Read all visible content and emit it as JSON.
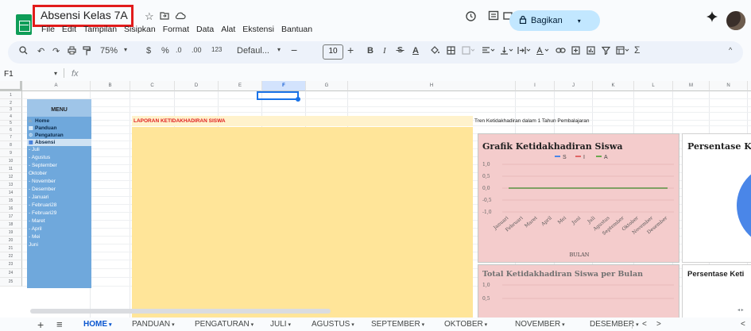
{
  "window": {
    "title": "Absensi Kelas 7A",
    "title_highlight_color": "#e21b1b",
    "menus": [
      "File",
      "Edit",
      "Tampilan",
      "Sisipkan",
      "Format",
      "Data",
      "Alat",
      "Ekstensi",
      "Bantuan"
    ],
    "share_label": "Bagikan",
    "icons": [
      "star-icon",
      "move-to-folder-icon",
      "cloud-status-icon",
      "history-icon",
      "comment-icon",
      "meet-icon",
      "lock-icon",
      "gemini-icon"
    ]
  },
  "toolbar": {
    "zoom": "75%",
    "currency": "$",
    "percent": "%",
    "decrease_decimal": ".0",
    "increase_decimal": ".00",
    "number_format": "123",
    "font": "Defaul...",
    "font_size": "10",
    "bold": "B",
    "italic": "I",
    "text_color": "A",
    "text_color_bar": "#000000",
    "minus": "−",
    "plus": "+",
    "sigma": "Σ"
  },
  "formula_bar": {
    "cell_ref": "F1",
    "fx": "fx"
  },
  "grid": {
    "columns": [
      "A",
      "B",
      "C",
      "D",
      "E",
      "F",
      "G",
      "H",
      "I",
      "J",
      "K",
      "L",
      "M",
      "N",
      "O"
    ],
    "selected_column": "F",
    "rows": [
      "1",
      "2",
      "3",
      "4",
      "5",
      "6",
      "7",
      "8",
      "9",
      "10",
      "11",
      "12",
      "13",
      "14",
      "15",
      "16",
      "17",
      "18",
      "19",
      "20",
      "21",
      "22",
      "23",
      "24",
      "25"
    ]
  },
  "menu": {
    "header": "MENU",
    "items": [
      {
        "label": "Home",
        "icon": "home-icon",
        "style": "bold"
      },
      {
        "label": "Panduan",
        "icon": "book-icon",
        "style": "bold"
      },
      {
        "label": "Pengaturan",
        "icon": "settings-icon",
        "style": "bold"
      },
      {
        "label": "Absensi",
        "icon": "calendar-icon",
        "style": "bold-light"
      },
      {
        "label": "- Juli"
      },
      {
        "label": "- Agustus"
      },
      {
        "label": "- September"
      },
      {
        "label": "  Oktober"
      },
      {
        "label": "- November"
      },
      {
        "label": "- Desember"
      },
      {
        "label": "- Januari"
      },
      {
        "label": "- Februari28"
      },
      {
        "label": "- Februari29"
      },
      {
        "label": "- Maret"
      },
      {
        "label": "- April"
      },
      {
        "label": "- Mei"
      },
      {
        "label": "  Juni"
      }
    ],
    "panel_color": "#6fa8dc",
    "header_color": "#9fc5e8"
  },
  "report": {
    "title": "LAPORAN KETIDAKHADIRAN SISWA",
    "title_color": "#e02020",
    "trend_label": "Tren Ketidakhadiran dalam 1 Tahun Pembalajaran",
    "fill_color": "#ffe599"
  },
  "charts": {
    "chart1_title": "Grafik Ketidakhadiran Siswa",
    "chart2_title": "Total Ketidakhadiran Siswa per Bulan",
    "chart3_title": "Persentase Kel",
    "chart4_title": "Persentase Keti"
  },
  "chart_data": [
    {
      "type": "line",
      "title": "Grafik Ketidakhadiran Siswa",
      "xlabel": "BULAN",
      "ylabel": "",
      "categories": [
        "Januari",
        "Februari",
        "Maret",
        "April",
        "Mei",
        "Juni",
        "Juli",
        "Agustus",
        "September",
        "Oktober",
        "November",
        "Desember"
      ],
      "yticks": [
        "1,0",
        "0,5",
        "0,0",
        "-0,5",
        "-1,0"
      ],
      "ylim": [
        -1,
        1
      ],
      "legend": "top",
      "grid": true,
      "series": [
        {
          "name": "S",
          "color": "#4a86e8",
          "values": [
            0,
            0,
            0,
            0,
            0,
            0,
            0,
            0,
            0,
            0,
            0,
            0
          ]
        },
        {
          "name": "I",
          "color": "#e06666",
          "values": [
            0,
            0,
            0,
            0,
            0,
            0,
            0,
            0,
            0,
            0,
            0,
            0
          ]
        },
        {
          "name": "A",
          "color": "#6aa84f",
          "values": [
            0,
            0,
            0,
            0,
            0,
            0,
            0,
            0,
            0,
            0,
            0,
            0
          ]
        }
      ]
    },
    {
      "type": "bar",
      "title": "Total Ketidakhadiran Siswa per Bulan",
      "yticks": [
        "1,0",
        "0,5"
      ],
      "ylim": [
        0,
        1
      ],
      "grid": true
    },
    {
      "type": "pie",
      "title": "Persentase Kel",
      "color": "#4a86e8"
    }
  ],
  "tabs": {
    "add": "+",
    "all_sheets": "≡",
    "items": [
      "HOME",
      "PANDUAN",
      "PENGATURAN",
      "JULI",
      "AGUSTUS",
      "SEPTEMBER",
      "OKTOBER",
      "NOVEMBER",
      "DESEMBER"
    ],
    "active": "HOME",
    "prev": "<",
    "next": ">"
  }
}
